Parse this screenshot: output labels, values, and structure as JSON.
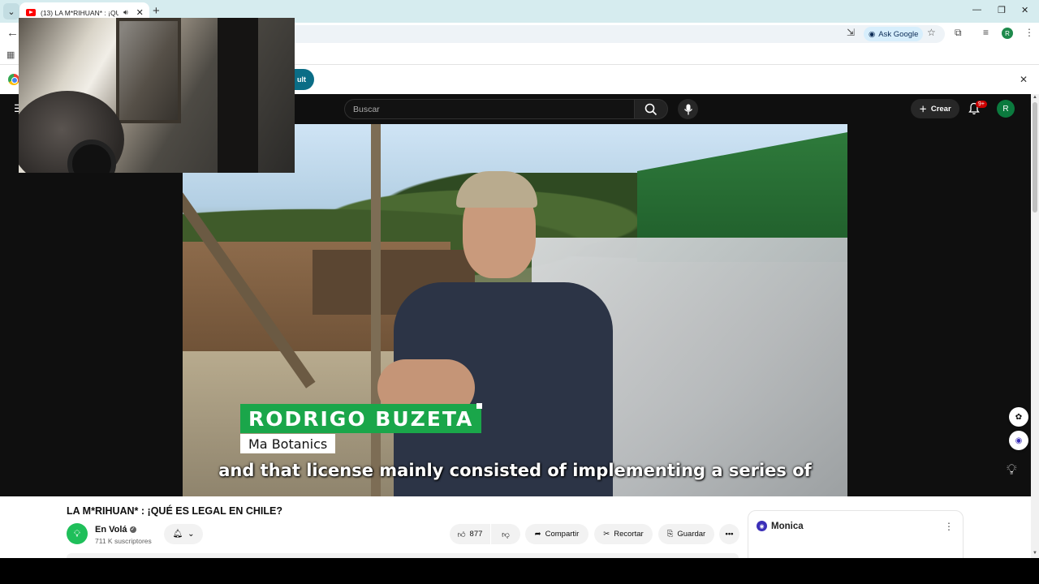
{
  "browser": {
    "tab_title": "(13) LA M*RIHUAN* : ¡QUÉ",
    "new_tab_symbol": "+",
    "ask_google": "Ask Google",
    "profile_initial": "R",
    "infobar_button": "ult"
  },
  "youtube": {
    "search_placeholder": "Buscar",
    "create_label": "Crear",
    "notifications_badge": "9+",
    "avatar_initial": "R"
  },
  "video": {
    "name_caption": "RODRIGO BUZETA",
    "org_caption": "Ma Botanics",
    "subtitle": "and that license mainly consisted of implementing a series of"
  },
  "details": {
    "title": "LA M*RIHUAN* : ¡QUÉ ES LEGAL EN CHILE?",
    "channel_name": "En Volá",
    "subscribers": "711 K suscriptores",
    "likes": "877",
    "share_label": "Compartir",
    "clip_label": "Recortar",
    "save_label": "Guardar"
  },
  "monica": {
    "title": "Monica"
  }
}
